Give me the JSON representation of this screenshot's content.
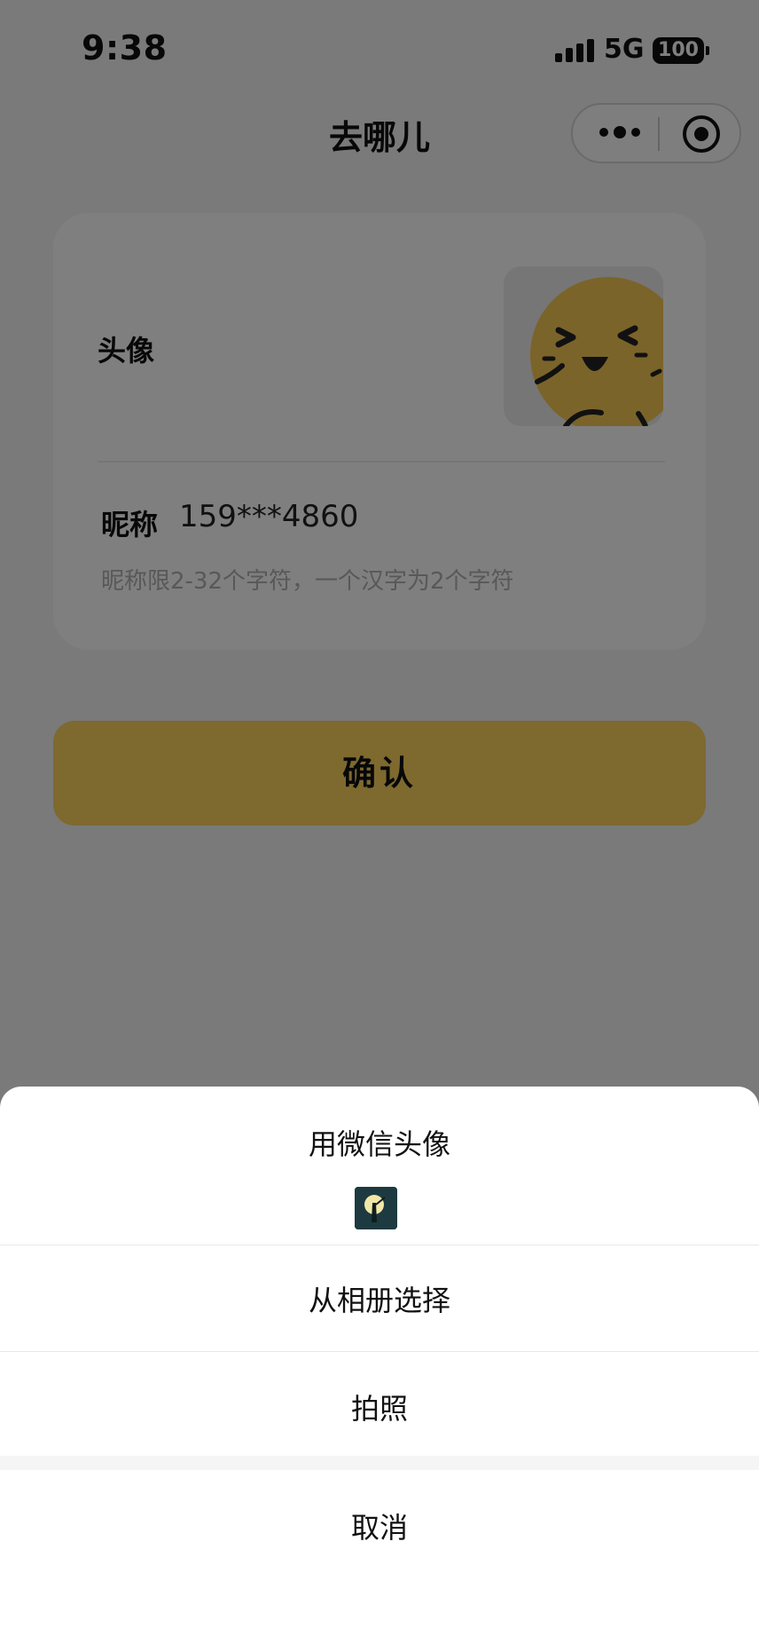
{
  "status_bar": {
    "time": "9:38",
    "network": "5G",
    "battery": "100"
  },
  "nav": {
    "title": "去哪儿",
    "more_icon": "more-dots-icon",
    "close_icon": "target-icon"
  },
  "profile": {
    "avatar_label": "头像",
    "avatar_icon": "smiley-avatar-icon",
    "nickname_label": "昵称",
    "nickname_value": "159***4860",
    "nickname_hint": "昵称限2-32个字符，一个汉字为2个字符"
  },
  "confirm": {
    "label": "确认",
    "color": "#fdd35f"
  },
  "action_sheet": {
    "use_wechat_avatar": "用微信头像",
    "wechat_avatar_icon": "wechat-avatar-thumbnail",
    "choose_from_album": "从相册选择",
    "take_photo": "拍照",
    "cancel": "取消"
  }
}
